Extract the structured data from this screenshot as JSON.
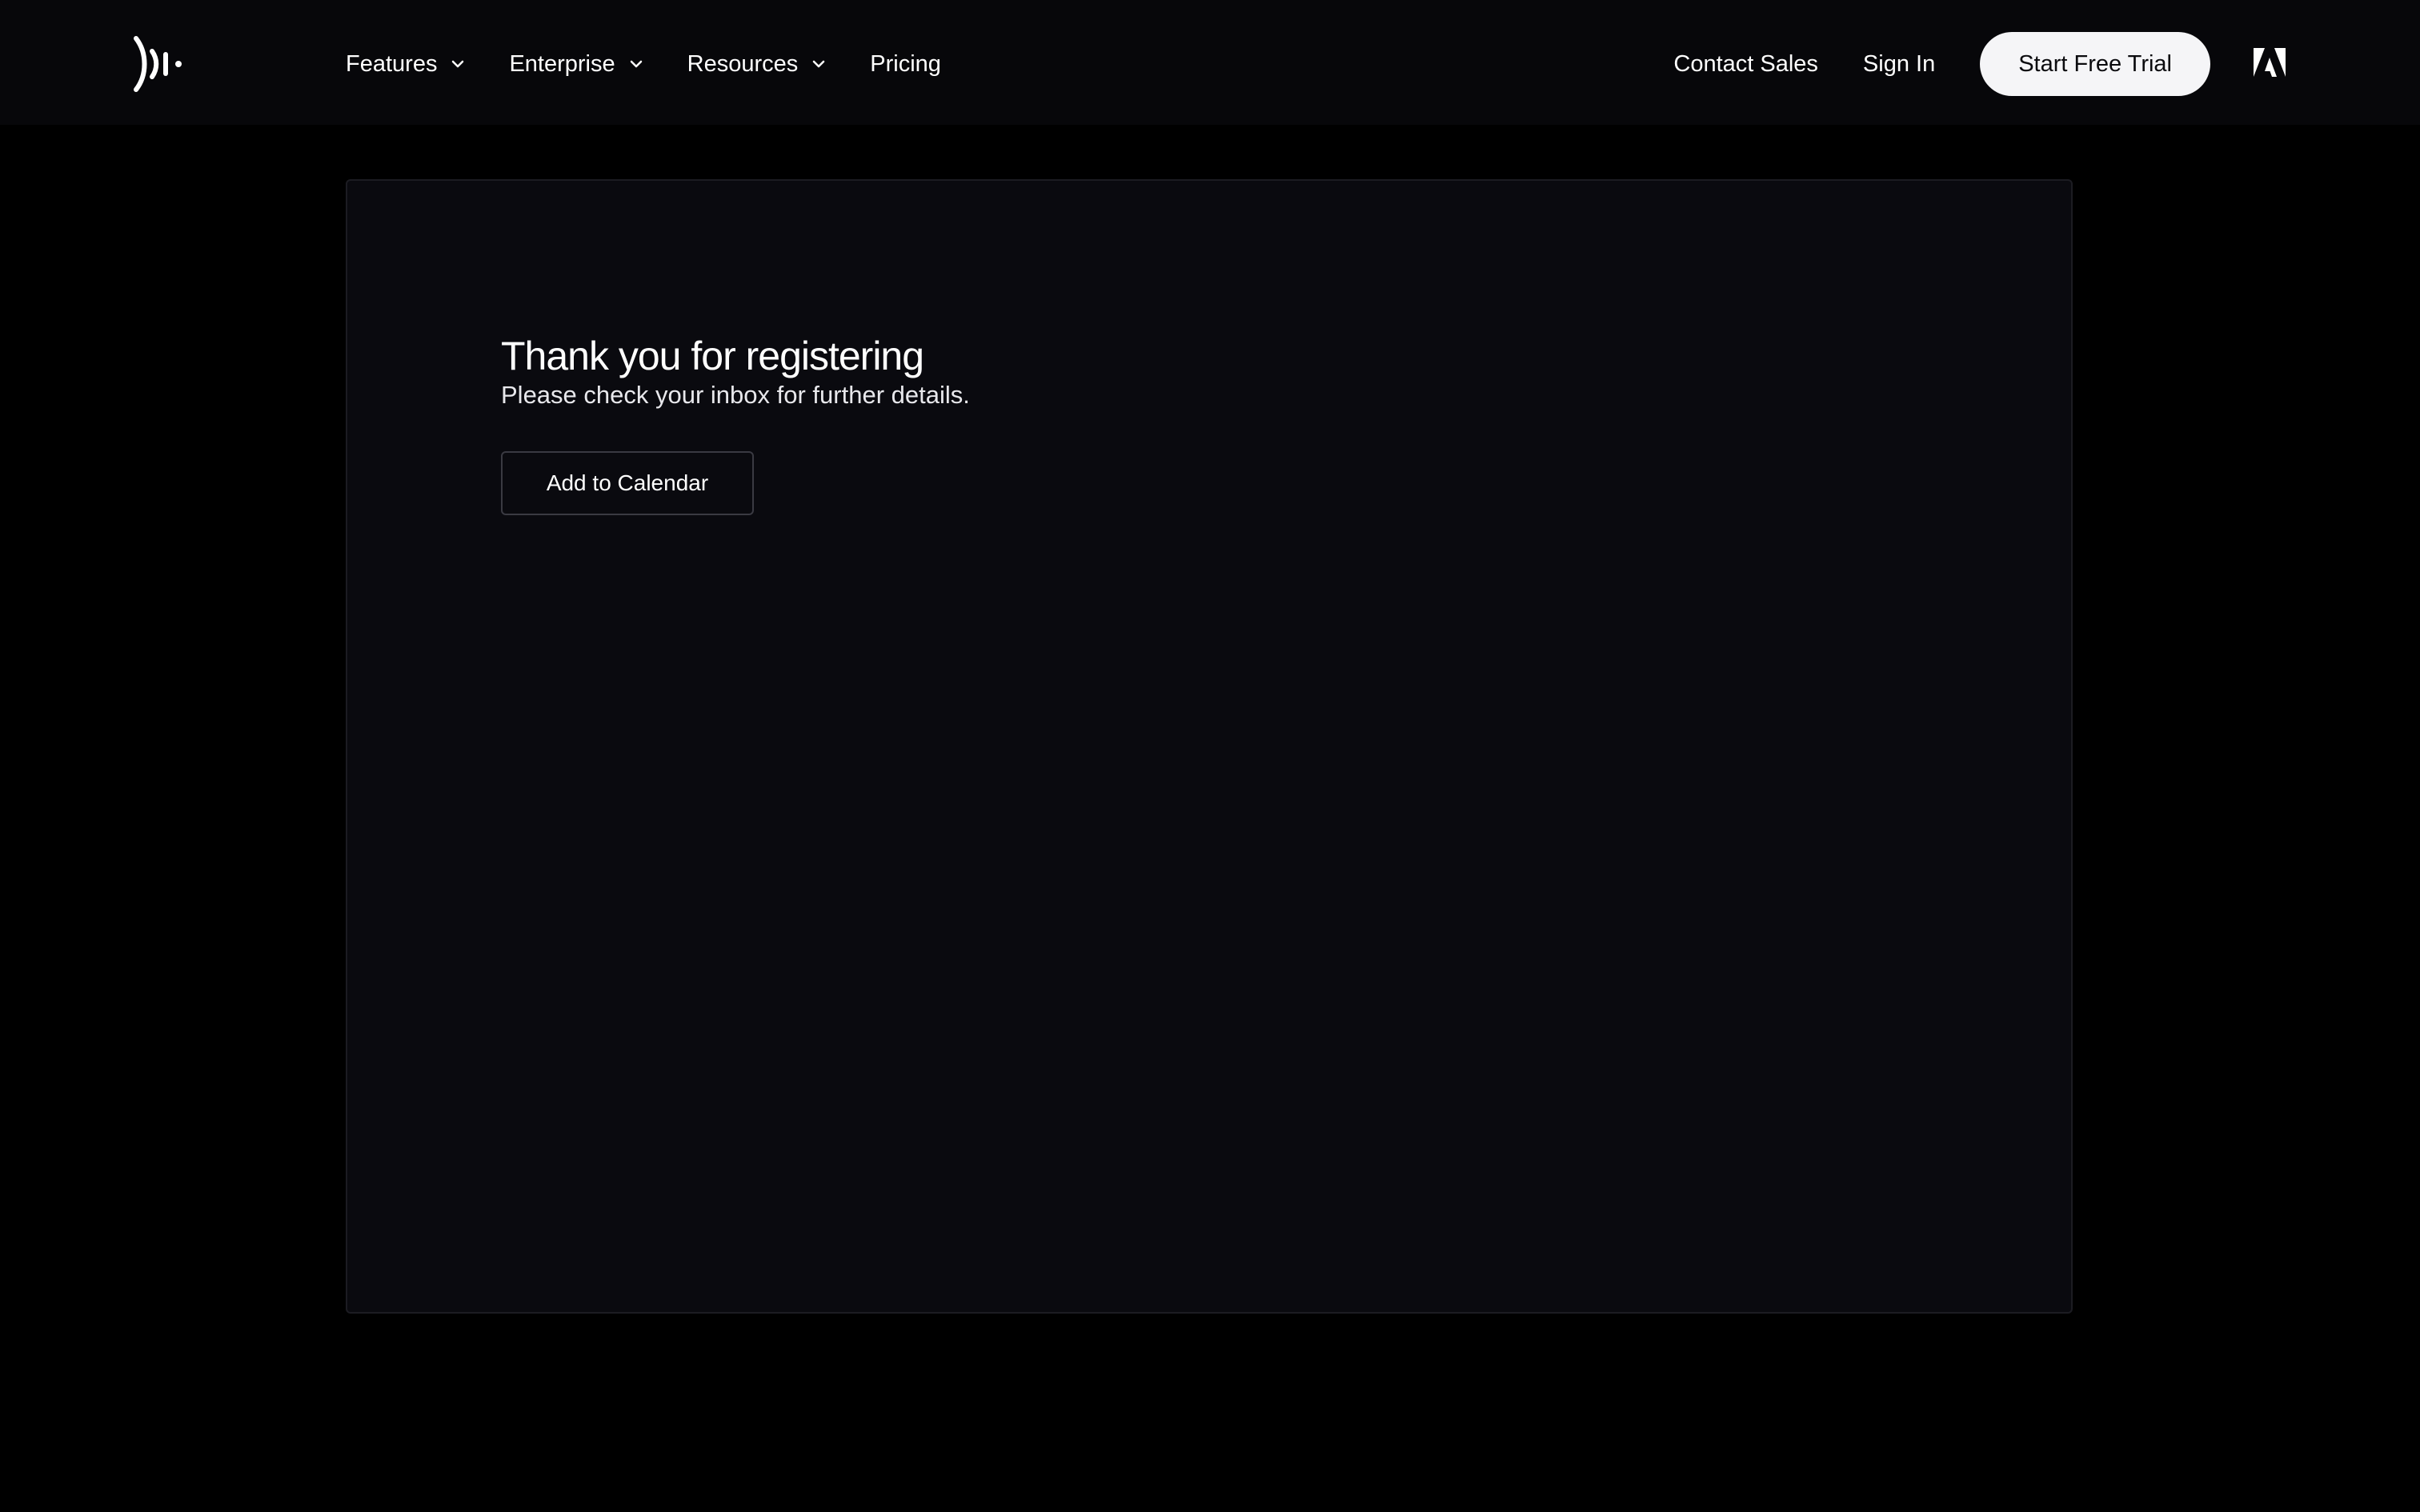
{
  "header": {
    "logo_icon": "soundwave-logo-icon",
    "nav": [
      {
        "label": "Features",
        "has_dropdown": true
      },
      {
        "label": "Enterprise",
        "has_dropdown": true
      },
      {
        "label": "Resources",
        "has_dropdown": true
      },
      {
        "label": "Pricing",
        "has_dropdown": false
      }
    ],
    "contact_sales": "Contact Sales",
    "sign_in": "Sign In",
    "start_trial": "Start Free Trial",
    "partner_icon": "adobe-logo-icon"
  },
  "confirmation": {
    "title": "Thank you for registering",
    "subtitle": "Please check your inbox for further details.",
    "calendar_button": "Add to Calendar"
  },
  "colors": {
    "page_background": "#000000",
    "header_background": "#07070a",
    "card_background": "#0a0a0f",
    "card_border": "#1c1c22",
    "primary_button_bg": "#f5f5f7",
    "primary_button_text": "#0b0b0e",
    "outline_button_border": "#3a3a42"
  }
}
